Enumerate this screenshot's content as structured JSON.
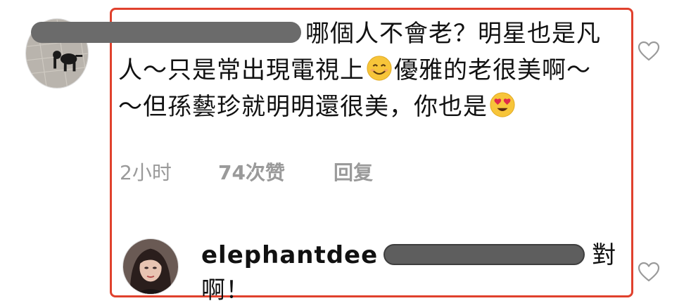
{
  "comment": {
    "text_1": "哪個人不會老？明星也是凡人～只是常出現電視上",
    "text_2": "優雅的老很美啊～～但孫藝珍就明明還很美，你也是",
    "time": "2小时",
    "likes": "74次赞",
    "reply_label": "回复",
    "emoji_1": "smiling-face-emoji",
    "emoji_2": "heart-eyes-emoji"
  },
  "reply": {
    "username": "elephantdee",
    "text": "對啊！"
  },
  "colors": {
    "highlight_border": "#e0412d",
    "meta_text": "#9a9a9a",
    "redaction": "#6b6b6b"
  },
  "icons": {
    "like": "heart-outline-icon"
  }
}
